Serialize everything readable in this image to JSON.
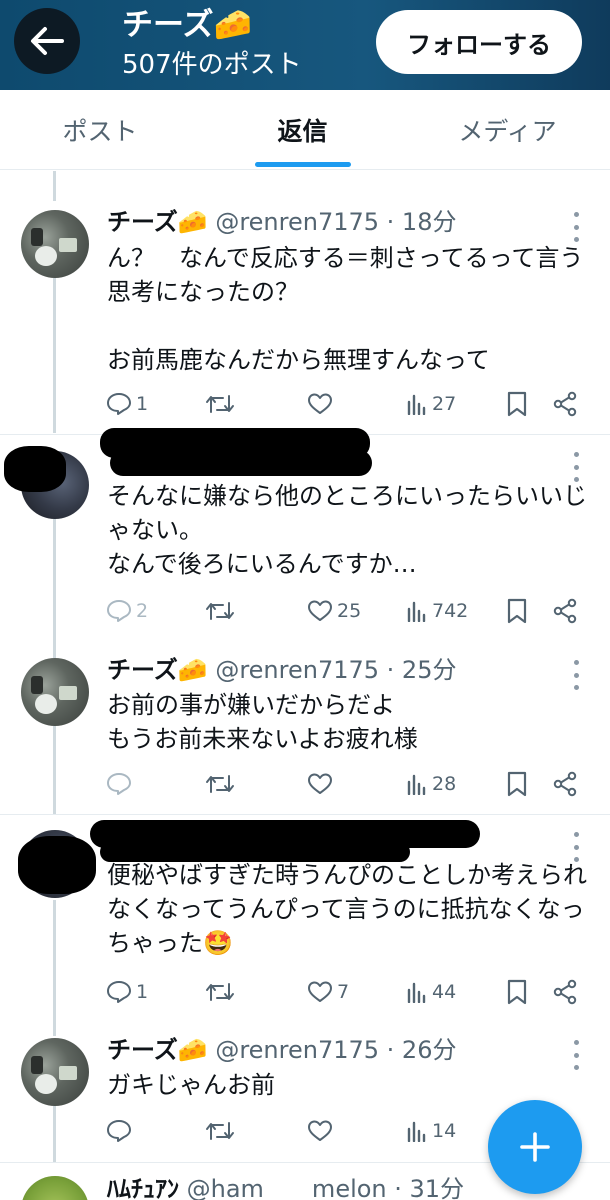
{
  "header": {
    "title": "チーズ🧀",
    "subtitle": "507件のポスト",
    "follow_label": "フォローする"
  },
  "tabs": [
    {
      "label": "ポスト",
      "active": false
    },
    {
      "label": "返信",
      "active": true
    },
    {
      "label": "メディア",
      "active": false
    }
  ],
  "posts": [
    {
      "name": "チーズ🧀",
      "meta": "@renren7175 · 18分",
      "text": "ん？　なんで反応する＝刺さってるって言う思考になったの？\n\nお前馬鹿なんだから無理すんなって",
      "replies": "1",
      "retweets": "",
      "likes": "",
      "views": "27"
    },
    {
      "name": "",
      "meta": "",
      "text": "そんなに嫌なら他のところにいったらいいじゃない。\nなんで後ろにいるんですか…",
      "replies": "2",
      "retweets": "",
      "likes": "25",
      "views": "742"
    },
    {
      "name": "チーズ🧀",
      "meta": "@renren7175 · 25分",
      "text": "お前の事が嫌いだからだよ\nもうお前未来ないよお疲れ様",
      "replies": "",
      "retweets": "",
      "likes": "",
      "views": "28"
    },
    {
      "name": "",
      "meta": "",
      "text": "便秘やばすぎた時うんぴのことしか考えられなくなってうんぴって言うのに抵抗なくなっちゃった🤩",
      "replies": "1",
      "retweets": "",
      "likes": "7",
      "views": "44"
    },
    {
      "name": "チーズ🧀",
      "meta": "@renren7175 · 26分",
      "text": "ガキじゃんお前",
      "replies": "",
      "retweets": "",
      "likes": "",
      "views": "14"
    },
    {
      "name": "ﾊﾑﾁｭｱﾝ",
      "meta": "@ham　　melon · 31分",
      "text": "",
      "replies": "",
      "retweets": "",
      "likes": "",
      "views": ""
    }
  ],
  "icons": {
    "back": "arrow-left-icon",
    "reply": "comment-icon",
    "retweet": "retweet-icon",
    "like": "heart-icon",
    "views": "bar-chart-icon",
    "bookmark": "bookmark-icon",
    "share": "share-icon",
    "compose": "plus-icon"
  },
  "colors": {
    "accent": "#1d9bf0",
    "header_bg": "#17577e",
    "muted": "#536471"
  }
}
